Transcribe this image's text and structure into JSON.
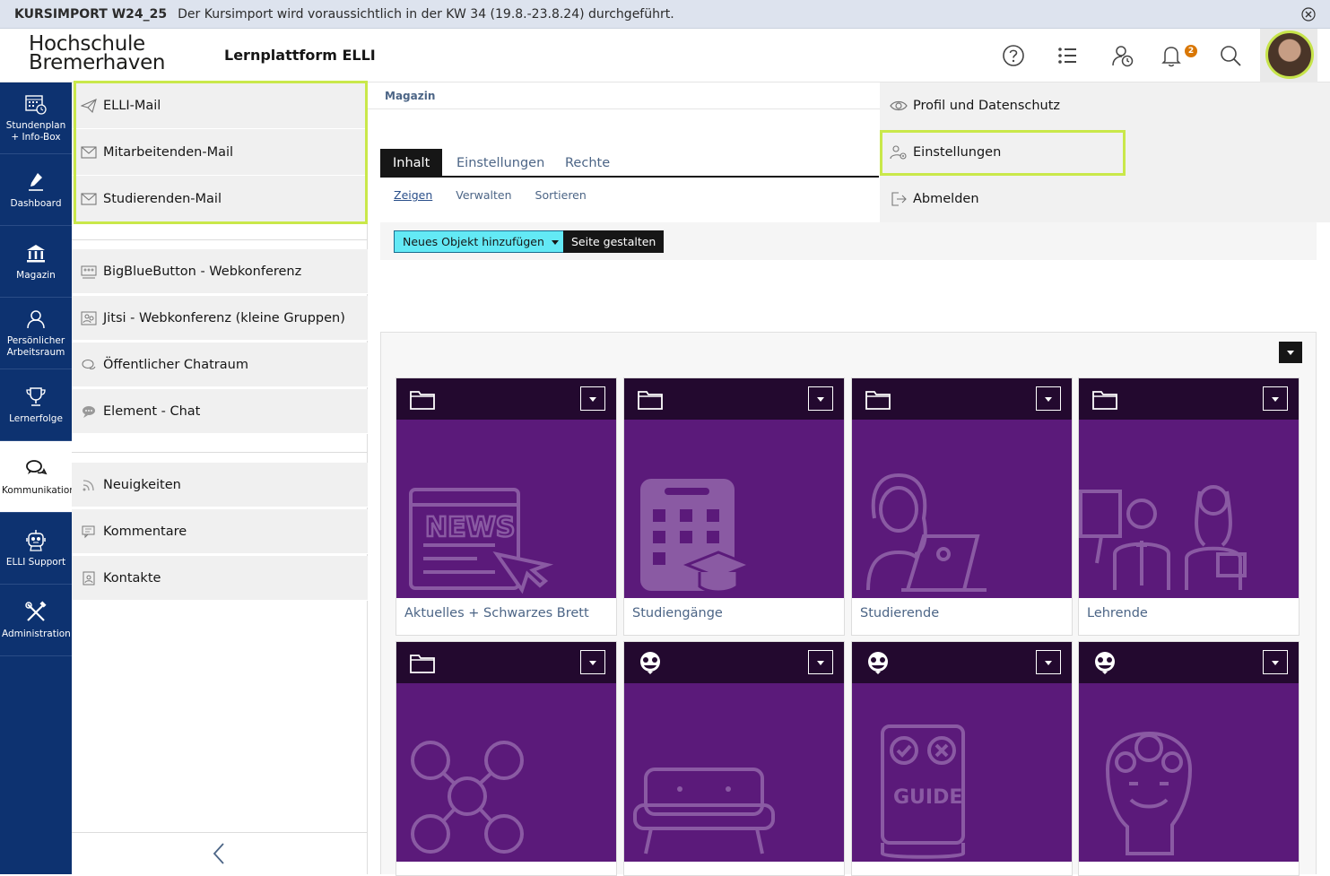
{
  "notice": {
    "tag": "KURSIMPORT W24_25",
    "text": "Der Kursimport wird voraussichtlich in der KW 34 (19.8.-23.8.24) durchgeführt."
  },
  "header": {
    "logo_line1": "Hochschule",
    "logo_line2": "Bremerhaven",
    "app_name": "Lernplattform ELLI",
    "notification_count": "2",
    "icons": [
      "help-icon",
      "list-icon",
      "user-clock-icon",
      "bell-icon",
      "search-icon"
    ]
  },
  "rail": {
    "items": [
      {
        "label": "Stundenplan + Info-Box",
        "icon": "calendar-clock-icon"
      },
      {
        "label": "Dashboard",
        "icon": "pen-icon"
      },
      {
        "label": "Magazin",
        "icon": "institution-icon"
      },
      {
        "label": "Persönlicher Arbeitsraum",
        "icon": "person-icon"
      },
      {
        "label": "Lernerfolge",
        "icon": "trophy-icon"
      },
      {
        "label": "Kommunikation",
        "icon": "chat-bubbles-icon"
      },
      {
        "label": "ELLI Support",
        "icon": "robot-icon"
      },
      {
        "label": "Administration",
        "icon": "tools-icon"
      }
    ]
  },
  "slate": {
    "group1": [
      {
        "label": "ELLI-Mail",
        "icon": "paper-plane-icon"
      },
      {
        "label": "Mitarbeitenden-Mail",
        "icon": "envelope-icon"
      },
      {
        "label": "Studierenden-Mail",
        "icon": "envelope-icon"
      }
    ],
    "group2": [
      {
        "label": "BigBlueButton - Webkonferenz",
        "icon": "conference-icon"
      },
      {
        "label": "Jitsi - Webkonferenz (kleine Gruppen)",
        "icon": "video-group-icon"
      },
      {
        "label": "Öffentlicher Chatraum",
        "icon": "chat-icon"
      },
      {
        "label": "Element - Chat",
        "icon": "element-chat-icon"
      }
    ],
    "group3": [
      {
        "label": "Neuigkeiten",
        "icon": "rss-icon"
      },
      {
        "label": "Kommentare",
        "icon": "comment-icon"
      },
      {
        "label": "Kontakte",
        "icon": "contacts-icon"
      }
    ]
  },
  "main": {
    "breadcrumb": "Magazin",
    "tabs": [
      "Inhalt",
      "Einstellungen",
      "Rechte"
    ],
    "subtabs": [
      "Zeigen",
      "Verwalten",
      "Sortieren"
    ],
    "add_button": "Neues Objekt hinzufügen",
    "page_button": "Seite gestalten",
    "tiles": [
      {
        "caption": "Aktuelles + Schwarzes Brett",
        "type": "folder",
        "image": "news-icon"
      },
      {
        "caption": "Studiengänge",
        "type": "folder",
        "image": "calendar-graduation-icon"
      },
      {
        "caption": "Studierende",
        "type": "folder",
        "image": "student-laptop-icon"
      },
      {
        "caption": "Lehrende",
        "type": "folder",
        "image": "teachers-icon"
      },
      {
        "caption": "",
        "type": "folder",
        "image": "network-people-icon"
      },
      {
        "caption": "",
        "type": "group",
        "image": "sofa-icon"
      },
      {
        "caption": "",
        "type": "group",
        "image": "guide-icon"
      },
      {
        "caption": "",
        "type": "group",
        "image": "head-gears-icon"
      }
    ]
  },
  "user_menu": {
    "items": [
      "Profil und Datenschutz",
      "Einstellungen",
      "Abmelden"
    ]
  },
  "colors": {
    "rail": "#0d3270",
    "highlight": "#c9e84a",
    "tile_image": "#5b1a7a",
    "tile_top": "#23092f",
    "add_button": "#63e9f5"
  }
}
